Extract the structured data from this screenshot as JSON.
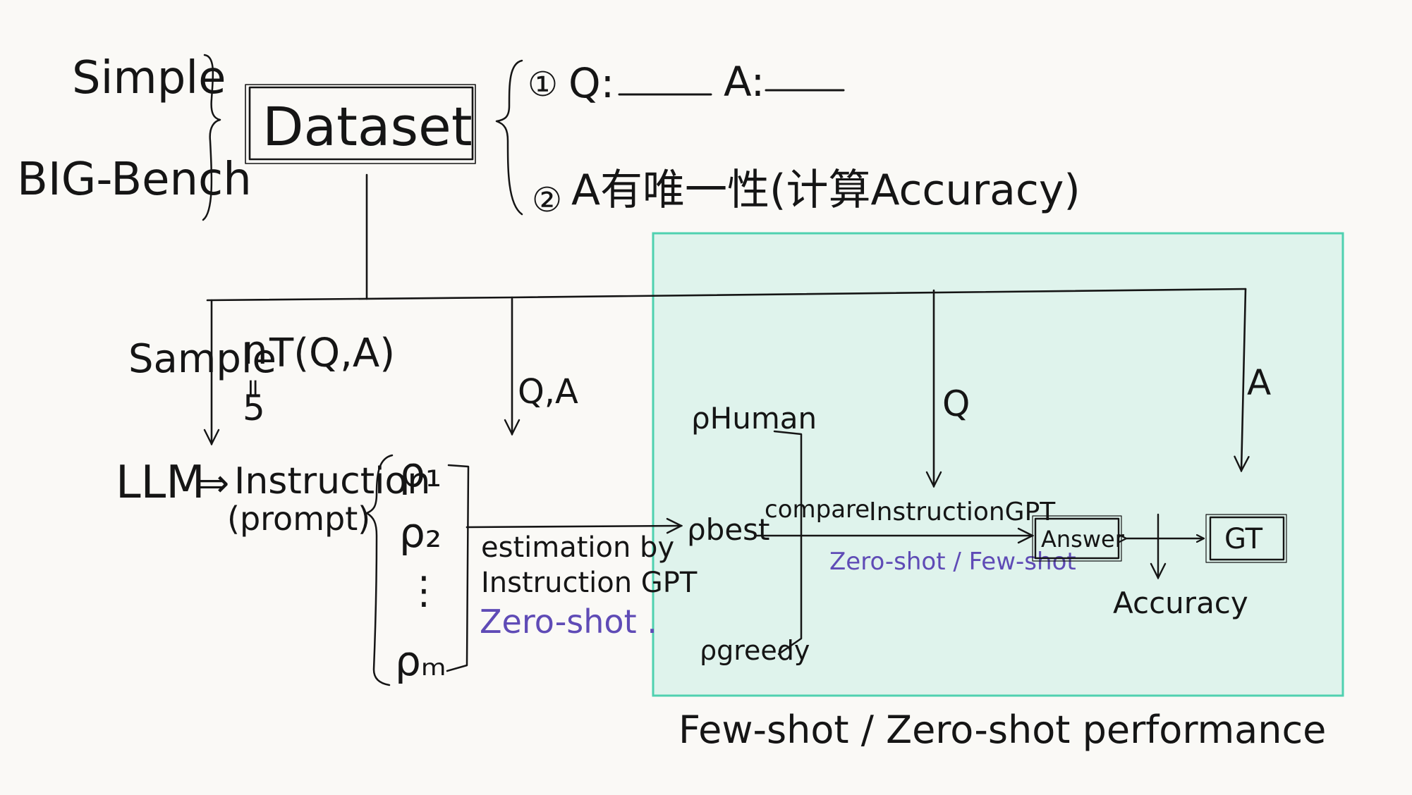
{
  "sources": {
    "simple": "Simple",
    "big_bench": "BIG-Bench"
  },
  "dataset": {
    "label": "Dataset"
  },
  "requirements": {
    "item1_num": "①",
    "item1_q": "Q:",
    "item1_a": "A:",
    "item2_num": "②",
    "item2_text": "A有唯一性(计算Accuracy)"
  },
  "sampling": {
    "label": "Sample",
    "n": "n",
    "pairs": "T(Q,A)",
    "equals": "=",
    "count": "5"
  },
  "generation": {
    "llm": "LLM",
    "arrow": "⇒",
    "instruction": "Instruction",
    "prompt": "(prompt)"
  },
  "prompts": {
    "p1": "ρ₁",
    "p2": "ρ₂",
    "dots": "⋮",
    "pm": "ρₘ"
  },
  "qa_label": "Q,A",
  "estimation": {
    "line1": "estimation by",
    "line2": "Instruction GPT",
    "line3": "Zero-shot ."
  },
  "evaluation": {
    "p_human": "ρHuman",
    "p_best": "ρbest",
    "p_greedy": "ρgreedy",
    "compare": "compare",
    "model": "InstructionGPT",
    "mode": "Zero-shot / Few-shot",
    "q_label": "Q",
    "a_label": "A",
    "answer": "Answer",
    "gt": "GT",
    "accuracy": "Accuracy",
    "caption": "Few-shot / Zero-shot performance"
  },
  "colors": {
    "highlight_fill": "#dff3ec",
    "highlight_border": "#4fd1b0",
    "ink": "#151515",
    "purple": "#5f4bb6"
  }
}
